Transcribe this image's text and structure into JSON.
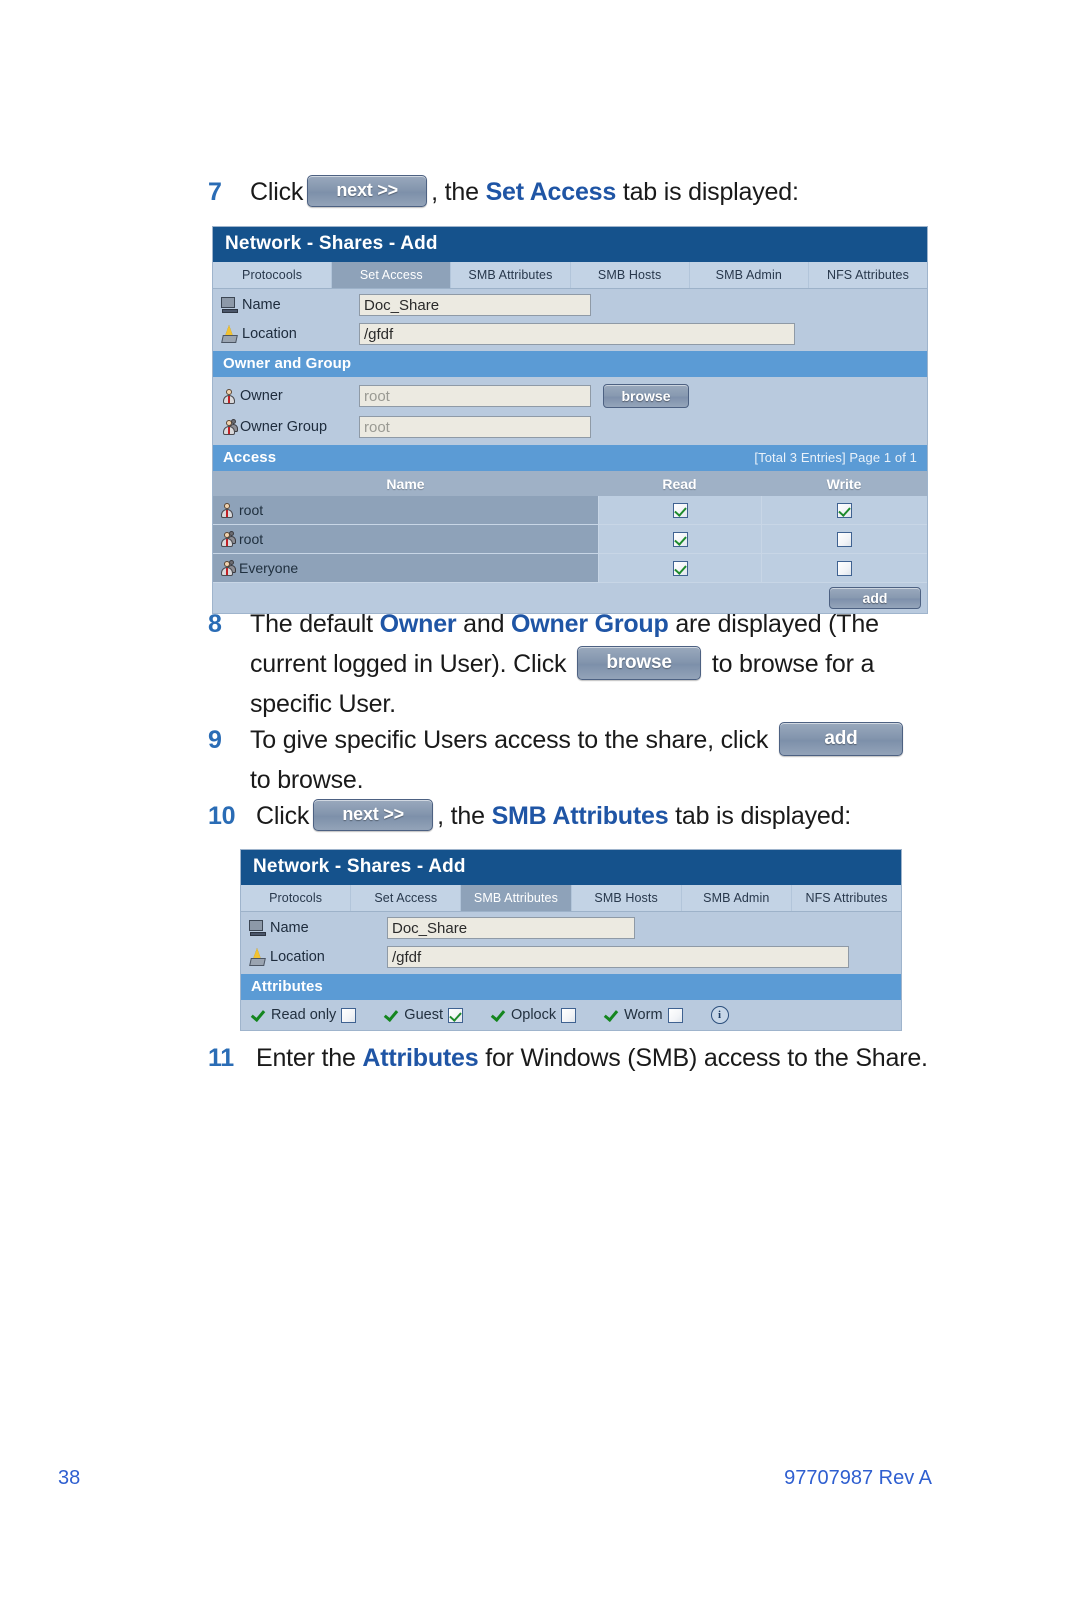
{
  "document": {
    "page_number": "38",
    "doc_id": "97707987 Rev A"
  },
  "steps": {
    "step7": {
      "number": "7",
      "text_before": "Click",
      "button_label": "next >>",
      "text_middle": ", the ",
      "bold_blue": "Set Access",
      "text_after": " tab is displayed:"
    },
    "step8": {
      "number": "8",
      "part1": "The default ",
      "bold1": "Owner",
      "part2": " and ",
      "bold2": "Owner Group",
      "part3": " are displayed (The current logged in User). Click ",
      "button_label": "browse",
      "part4": " to browse for a specific User."
    },
    "step9": {
      "number": "9",
      "part1": "To give specific Users access to the share, click ",
      "button_label": "add",
      "part2": " to browse."
    },
    "step10": {
      "number": "10",
      "text_before": "Click",
      "button_label": "next >>",
      "text_middle": ", the ",
      "bold_blue": "SMB Attributes",
      "text_after": " tab is displayed:"
    },
    "step11": {
      "number": "11",
      "part1": "Enter the ",
      "bold1": "Attributes",
      "part2": " for Windows (SMB) access to the Share."
    }
  },
  "screenshot_set_access": {
    "title": "Network - Shares - Add",
    "tabs": [
      {
        "label": "Protocools",
        "active": false
      },
      {
        "label": "Set Access",
        "active": true
      },
      {
        "label": "SMB Attributes",
        "active": false
      },
      {
        "label": "SMB Hosts",
        "active": false
      },
      {
        "label": "SMB Admin",
        "active": false
      },
      {
        "label": "NFS Attributes",
        "active": false
      }
    ],
    "name_label": "Name",
    "name_value": "Doc_Share",
    "location_label": "Location",
    "location_value": "/gfdf",
    "owner_section": "Owner and Group",
    "owner_label": "Owner",
    "owner_value": "root",
    "browse_button": "browse",
    "owner_group_label": "Owner Group",
    "owner_group_value": "root",
    "access_section": "Access",
    "access_meta": "[Total 3 Entries] Page 1 of 1",
    "columns": [
      "Name",
      "Read",
      "Write"
    ],
    "rows": [
      {
        "name": "root",
        "icon": "user-icon",
        "read": true,
        "write": true
      },
      {
        "name": "root",
        "icon": "group-icon",
        "read": true,
        "write": false
      },
      {
        "name": "Everyone",
        "icon": "group-icon",
        "read": true,
        "write": false
      }
    ],
    "add_button": "add"
  },
  "screenshot_smb_attributes": {
    "title": "Network - Shares - Add",
    "tabs": [
      {
        "label": "Protocols",
        "active": false
      },
      {
        "label": "Set Access",
        "active": false
      },
      {
        "label": "SMB Attributes",
        "active": true
      },
      {
        "label": "SMB Hosts",
        "active": false
      },
      {
        "label": "SMB Admin",
        "active": false
      },
      {
        "label": "NFS Attributes",
        "active": false
      }
    ],
    "name_label": "Name",
    "name_value": "Doc_Share",
    "location_label": "Location",
    "location_value": "/gfdf",
    "attributes_section": "Attributes",
    "attributes": [
      {
        "label": "Read only",
        "checked": false
      },
      {
        "label": "Guest",
        "checked": true
      },
      {
        "label": "Oplock",
        "checked": false
      },
      {
        "label": "Worm",
        "checked": false
      }
    ],
    "info_icon": "i"
  },
  "colors": {
    "title_bar": "#15528c",
    "section_bar": "#5b9bd5",
    "accent_blue": "#1f55a5",
    "footer_blue": "#2f5fd0"
  }
}
